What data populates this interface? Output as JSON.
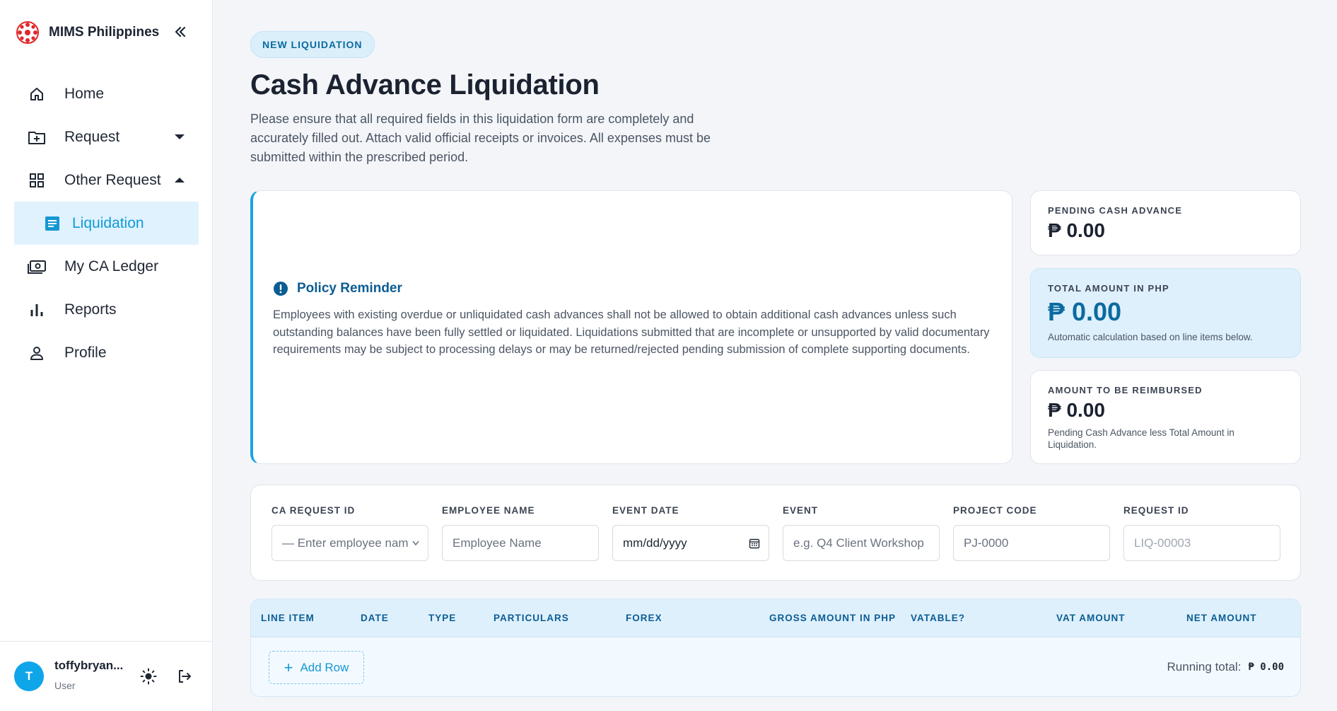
{
  "brand": {
    "name": "MIMS Philippines",
    "logo_color": "#e0272c"
  },
  "sidebar": {
    "items": [
      {
        "label": "Home",
        "icon": "home-icon"
      },
      {
        "label": "Request",
        "icon": "folder-plus-icon",
        "caret": "down"
      },
      {
        "label": "Other Request",
        "icon": "grid-icon",
        "caret": "up"
      },
      {
        "label": "Liquidation",
        "icon": "list-icon",
        "active": true
      },
      {
        "label": "My CA Ledger",
        "icon": "cash-icon"
      },
      {
        "label": "Reports",
        "icon": "bar-chart-icon"
      },
      {
        "label": "Profile",
        "icon": "person-icon"
      }
    ]
  },
  "user": {
    "initial": "T",
    "name": "toffybryan...",
    "role": "User"
  },
  "header": {
    "badge": "NEW LIQUIDATION",
    "title": "Cash Advance Liquidation",
    "description": "Please ensure that all required fields in this liquidation form are completely and accurately filled out. Attach valid official receipts or invoices. All expenses must be submitted within the prescribed period."
  },
  "policy": {
    "title": "Policy Reminder",
    "text": "Employees with existing overdue or unliquidated cash advances shall not be allowed to obtain additional cash advances unless such outstanding balances have been fully settled or liquidated. Liquidations submitted that are incomplete or unsupported by valid documentary requirements may be subject to processing delays or may be returned/rejected pending submission of complete supporting documents."
  },
  "stats": {
    "pending": {
      "label": "PENDING CASH ADVANCE",
      "value": "₱ 0.00"
    },
    "total": {
      "label": "TOTAL AMOUNT IN PHP",
      "value": "₱ 0.00",
      "note": "Automatic calculation based on line items below."
    },
    "reimburse": {
      "label": "AMOUNT TO BE REIMBURSED",
      "value": "₱ 0.00",
      "note": "Pending Cash Advance less Total Amount in Liquidation."
    }
  },
  "fields": {
    "ca_request_id": {
      "label": "CA REQUEST ID",
      "placeholder": "— Enter employee nam"
    },
    "employee_name": {
      "label": "EMPLOYEE NAME",
      "placeholder": "Employee Name"
    },
    "event_date": {
      "label": "EVENT DATE",
      "placeholder": "mm/dd/yyyy"
    },
    "event": {
      "label": "EVENT",
      "placeholder": "e.g. Q4 Client Workshop"
    },
    "project_code": {
      "label": "PROJECT CODE",
      "placeholder": "PJ-0000"
    },
    "request_id": {
      "label": "REQUEST ID",
      "value": "LIQ-00003"
    }
  },
  "table": {
    "columns": [
      "LINE ITEM",
      "DATE",
      "TYPE",
      "PARTICULARS",
      "FOREX",
      "GROSS AMOUNT IN PHP",
      "VATABLE?",
      "VAT AMOUNT",
      "NET AMOUNT"
    ],
    "add_row_label": "Add Row",
    "running_label": "Running total:",
    "running_value": "₱ 0.00"
  },
  "colors": {
    "accent": "#1aa4df",
    "accent_dark": "#0b5d93",
    "active_bg": "#e0f2fd"
  }
}
